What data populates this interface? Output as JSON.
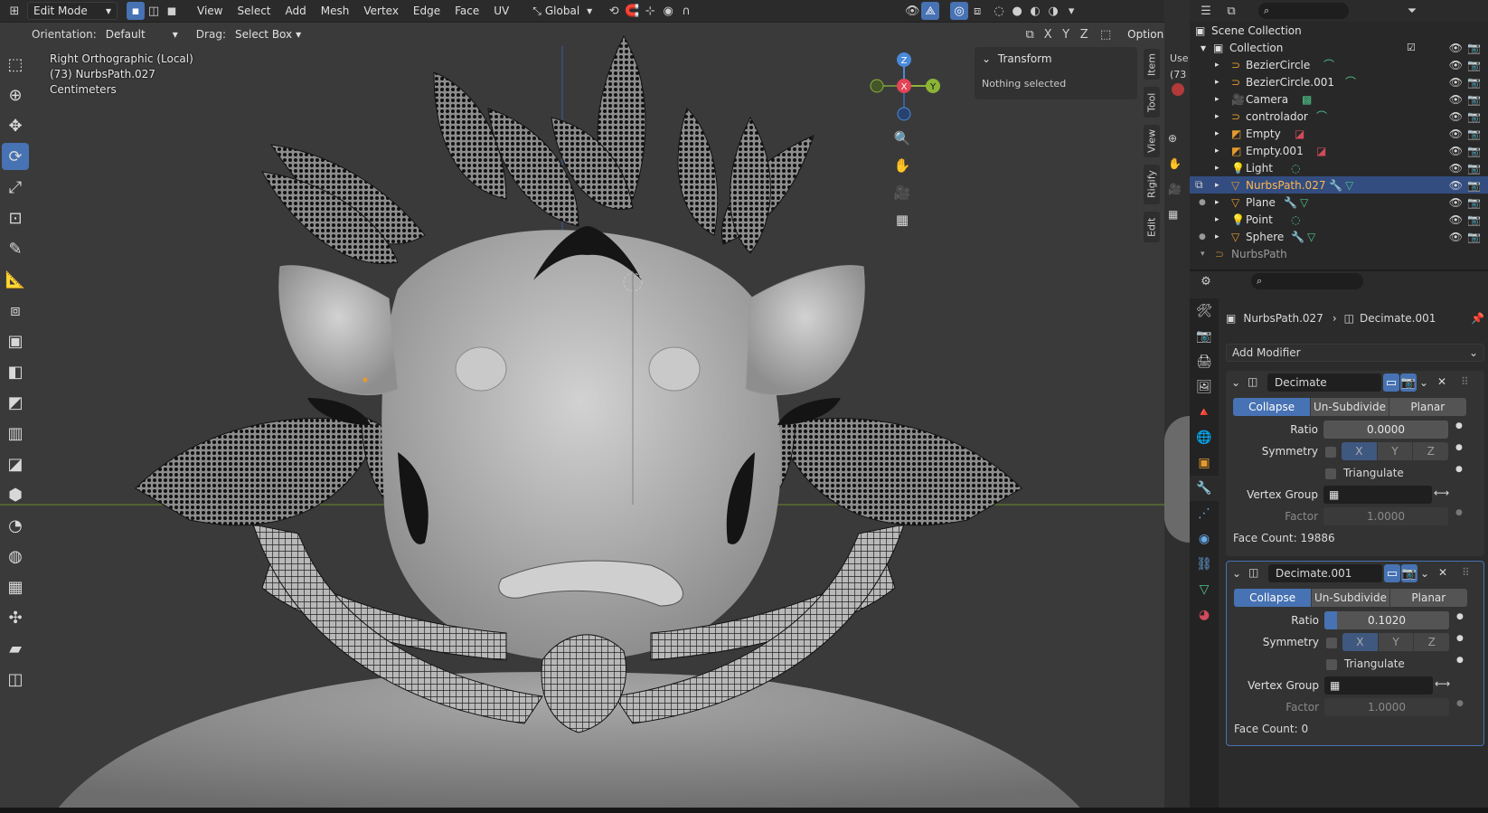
{
  "header": {
    "mode": "Edit Mode",
    "menus": [
      "View",
      "Select",
      "Add",
      "Mesh",
      "Vertex",
      "Edge",
      "Face",
      "UV"
    ],
    "transform_orientation": "Global",
    "options_label": "Options"
  },
  "subheader": {
    "orientation_label": "Orientation:",
    "orientation_value": "Default",
    "drag_label": "Drag:",
    "drag_value": "Select Box",
    "axes": [
      "X",
      "Y",
      "Z"
    ]
  },
  "viewport_info": {
    "view": "Right Orthographic (Local)",
    "object": "(73) NurbsPath.027",
    "units": "Centimeters"
  },
  "gizmo": {
    "z": "Z",
    "x": "X",
    "y": "Y"
  },
  "transform_panel": {
    "title": "Transform",
    "status": "Nothing selected"
  },
  "side_tabs": [
    "Item",
    "Tool",
    "View",
    "Rigify",
    "Edit"
  ],
  "partial_editor": {
    "label1": "Use",
    "label2": "(73"
  },
  "outliner": {
    "root": "Scene Collection",
    "collection": "Collection",
    "items": [
      {
        "name": "BezierCircle",
        "selected": false
      },
      {
        "name": "BezierCircle.001",
        "selected": false
      },
      {
        "name": "Camera",
        "selected": false
      },
      {
        "name": "controlador",
        "selected": false
      },
      {
        "name": "Empty",
        "selected": false
      },
      {
        "name": "Empty.001",
        "selected": false
      },
      {
        "name": "Light",
        "selected": false
      },
      {
        "name": "NurbsPath.027",
        "selected": true
      },
      {
        "name": "Plane",
        "selected": false
      },
      {
        "name": "Point",
        "selected": false
      },
      {
        "name": "Sphere",
        "selected": false
      }
    ],
    "extra": "NurbsPath"
  },
  "properties": {
    "breadcrumb_object": "NurbsPath.027",
    "breadcrumb_modifier": "Decimate.001",
    "add_modifier": "Add Modifier",
    "modifiers": [
      {
        "name": "Decimate",
        "modes": [
          "Collapse",
          "Un-Subdivide",
          "Planar"
        ],
        "ratio_label": "Ratio",
        "ratio": "0.0000",
        "ratio_fraction": 0.0,
        "symmetry_label": "Symmetry",
        "axes": [
          "X",
          "Y",
          "Z"
        ],
        "triangulate_label": "Triangulate",
        "vgroup_label": "Vertex Group",
        "factor_label": "Factor",
        "factor": "1.0000",
        "face_count": "Face Count: 19886"
      },
      {
        "name": "Decimate.001",
        "modes": [
          "Collapse",
          "Un-Subdivide",
          "Planar"
        ],
        "ratio_label": "Ratio",
        "ratio": "0.1020",
        "ratio_fraction": 0.102,
        "symmetry_label": "Symmetry",
        "axes": [
          "X",
          "Y",
          "Z"
        ],
        "triangulate_label": "Triangulate",
        "vgroup_label": "Vertex Group",
        "factor_label": "Factor",
        "factor": "1.0000",
        "face_count": "Face Count: 0"
      }
    ]
  },
  "colors": {
    "accent": "#4772b3",
    "selected_row": "#334d80",
    "x_axis": "#e54358",
    "y_axis": "#8bb437",
    "z_axis": "#4a8ad8"
  }
}
